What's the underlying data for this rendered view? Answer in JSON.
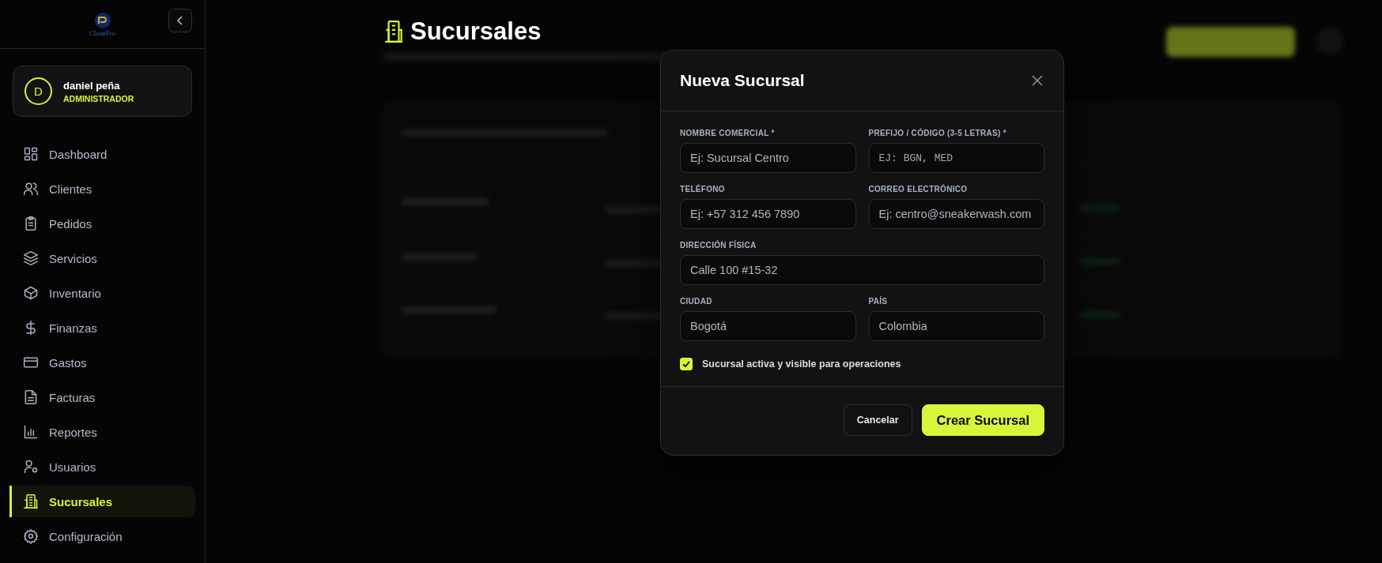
{
  "sidebar": {
    "logo": {
      "text": "CleanPro"
    },
    "user": {
      "initial": "D",
      "name": "daniel peña",
      "role": "ADMINISTRADOR"
    },
    "nav": [
      {
        "label": "Dashboard",
        "selected": false
      },
      {
        "label": "Clientes",
        "selected": false
      },
      {
        "label": "Pedidos",
        "selected": false
      },
      {
        "label": "Servicios",
        "selected": false
      },
      {
        "label": "Inventario",
        "selected": false
      },
      {
        "label": "Finanzas",
        "selected": false
      },
      {
        "label": "Gastos",
        "selected": false
      },
      {
        "label": "Facturas",
        "selected": false
      },
      {
        "label": "Reportes",
        "selected": false
      },
      {
        "label": "Usuarios",
        "selected": false
      },
      {
        "label": "Sucursales",
        "selected": true
      },
      {
        "label": "Configuración",
        "selected": false
      }
    ]
  },
  "page": {
    "title": "Sucursales"
  },
  "modal": {
    "title": "Nueva Sucursal",
    "rows": [
      [
        {
          "label": "NOMBRE COMERCIAL *",
          "placeholder": "Ej: Sucursal Centro",
          "kind": "text"
        },
        {
          "label": "PREFIJO / CÓDIGO (3-5 LETRAS) *",
          "placeholder": "EJ: BGN, MED",
          "kind": "code"
        }
      ],
      [
        {
          "label": "TELÉFONO",
          "placeholder": "Ej: +57 312 456 7890",
          "kind": "text"
        },
        {
          "label": "CORREO ELECTRÓNICO",
          "placeholder": "Ej: centro@sneakerwash.com",
          "kind": "text"
        }
      ],
      [
        {
          "label": "DIRECCIÓN FÍSICA",
          "placeholder": "Calle 100 #15-32",
          "kind": "text"
        }
      ],
      [
        {
          "label": "CIUDAD",
          "placeholder": "Bogotá",
          "kind": "text"
        },
        {
          "label": "PAÍS",
          "placeholder": "Colombia",
          "kind": "text"
        }
      ]
    ],
    "checkbox": {
      "label": "Sucursal activa y visible para operaciones",
      "checked": true
    },
    "buttons": [
      {
        "label": "Cancelar",
        "kind": "secondary"
      },
      {
        "label": "Crear Sucursal",
        "kind": "primary"
      }
    ]
  }
}
